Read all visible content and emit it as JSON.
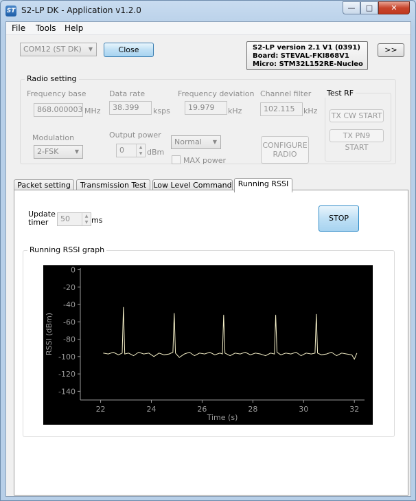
{
  "window": {
    "title": "S2-LP DK - Application v1.2.0",
    "icon_text": "ST",
    "controls": {
      "minimize": "—",
      "maximize": "□",
      "close": "✕"
    }
  },
  "menu": [
    "File",
    "Tools",
    "Help"
  ],
  "connection": {
    "port_value": "COM12 (ST DK)",
    "close_label": "Close",
    "expand_label": ">>"
  },
  "device_info": {
    "version": "S2-LP version 2.1 V1 (0391)",
    "board": "Board: STEVAL-FKI868V1",
    "micro": "Micro: STM32L152RE-Nucleo"
  },
  "radio_setting": {
    "title": "Radio setting",
    "frequency_base": {
      "label": "Frequency base",
      "value": "868.000003",
      "unit": "MHz"
    },
    "data_rate": {
      "label": "Data rate",
      "value": "38.399",
      "unit": "ksps"
    },
    "frequency_deviation": {
      "label": "Frequency deviation",
      "value": "19.979",
      "unit": "kHz"
    },
    "channel_filter": {
      "label": "Channel filter",
      "value": "102.115",
      "unit": "kHz"
    },
    "modulation": {
      "label": "Modulation",
      "value": "2-FSK"
    },
    "output_power": {
      "label": "Output power",
      "value": "0",
      "unit": "dBm"
    },
    "power_mode": {
      "value": "Normal"
    },
    "max_power": {
      "label": "MAX power"
    },
    "configure_label": "CONFIGURE\nRADIO"
  },
  "test_rf": {
    "title": "Test RF",
    "tx_cw_label": "TX CW START",
    "tx_pn9_label": "TX PN9 START"
  },
  "tabs": [
    {
      "label": "Packet setting"
    },
    {
      "label": "Transmission Test"
    },
    {
      "label": "Low Level Command"
    },
    {
      "label": "Running RSSI"
    }
  ],
  "running_rssi": {
    "update_timer_label": "Update\ntimer",
    "update_timer_value": "50",
    "update_timer_unit": "ms",
    "stop_label": "STOP",
    "graph_group_title": "Running RSSI graph"
  },
  "chart_data": {
    "type": "line",
    "xlabel": "Time (s)",
    "ylabel": "RSSI (dBm)",
    "xlim": [
      21.2,
      32.4
    ],
    "ylim": [
      -150,
      2
    ],
    "x_ticks": [
      22,
      24,
      26,
      28,
      30,
      32
    ],
    "y_ticks": [
      0,
      -20,
      -40,
      -60,
      -80,
      -100,
      -120,
      -140
    ],
    "background": "#000000",
    "line_color": "#f5f0c8",
    "axis_color": "#9a9a9a",
    "series": [
      {
        "x": [
          22.1,
          22.3,
          22.5,
          22.7,
          22.85,
          22.9,
          22.95,
          23.1,
          23.3,
          23.5,
          23.7,
          23.9,
          24.1,
          24.3,
          24.5,
          24.7,
          24.85,
          24.9,
          24.95,
          25.1,
          25.3,
          25.5,
          25.7,
          25.9,
          26.1,
          26.3,
          26.5,
          26.7,
          26.8,
          26.85,
          26.9,
          27.1,
          27.3,
          27.5,
          27.7,
          27.9,
          28.1,
          28.3,
          28.5,
          28.7,
          28.85,
          28.9,
          28.95,
          29.1,
          29.3,
          29.5,
          29.7,
          29.9,
          30.1,
          30.3,
          30.45,
          30.5,
          30.55,
          30.7,
          30.9,
          31.1,
          31.3,
          31.5,
          31.7,
          31.9,
          32.0,
          32.1
        ],
        "y": [
          -96,
          -97,
          -95,
          -98,
          -96,
          -43,
          -97,
          -96,
          -99,
          -95,
          -97,
          -96,
          -100,
          -96,
          -98,
          -97,
          -95,
          -50,
          -96,
          -101,
          -97,
          -95,
          -99,
          -96,
          -97,
          -95,
          -98,
          -96,
          -97,
          -52,
          -96,
          -99,
          -96,
          -97,
          -95,
          -98,
          -96,
          -97,
          -99,
          -96,
          -97,
          -52,
          -95,
          -98,
          -96,
          -97,
          -95,
          -99,
          -96,
          -97,
          -96,
          -51,
          -96,
          -98,
          -97,
          -95,
          -99,
          -96,
          -97,
          -98,
          -103,
          -96
        ]
      }
    ]
  }
}
